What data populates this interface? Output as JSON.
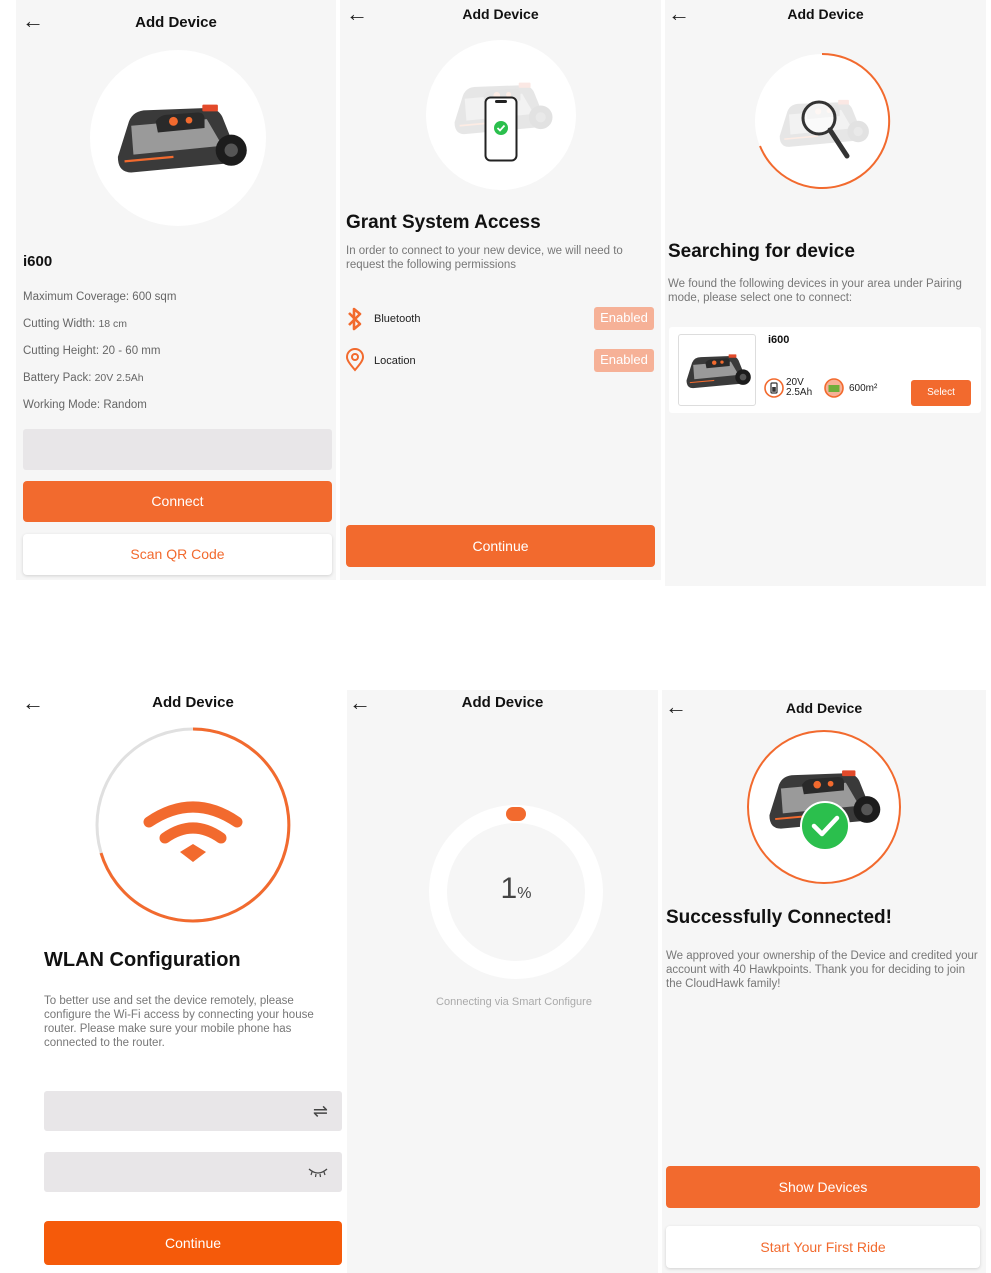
{
  "common": {
    "back_arrow": "←",
    "header_title": "Add Device"
  },
  "screen1": {
    "model": "i600",
    "specs": [
      {
        "label": "Maximum Coverage:",
        "value": "600 sqm"
      },
      {
        "label": "Cutting Width:",
        "value": "18 cm"
      },
      {
        "label": "Cutting Height:",
        "value": "20 - 60 mm"
      },
      {
        "label": "Battery Pack:",
        "value": "20V 2.5Ah"
      },
      {
        "label": "Working Mode:",
        "value": "Random"
      }
    ],
    "connect_label": "Connect",
    "scan_label": "Scan QR Code"
  },
  "screen2": {
    "heading": "Grant System Access",
    "description": "In order to connect to your new device, we will need to request the following permissions",
    "permissions": [
      {
        "name": "Bluetooth",
        "status": "Enabled"
      },
      {
        "name": "Location",
        "status": "Enabled"
      }
    ],
    "continue_label": "Continue"
  },
  "screen3": {
    "heading": "Searching for device",
    "description": "We found the following devices in your area under Pairing mode, please select one to connect:",
    "device": {
      "name": "i600",
      "battery_volts": "20V",
      "battery_capacity": "2.5Ah",
      "coverage": "600m²",
      "select_label": "Select"
    }
  },
  "screen4": {
    "heading": "WLAN Configuration",
    "description": "To better use and set the device remotely, please configure the Wi-Fi access by connecting your house router. Please make sure your mobile phone has connected to the router.",
    "swap_icon": "⇌",
    "continue_label": "Continue"
  },
  "screen5": {
    "progress_value": "1",
    "progress_unit": "%",
    "status_text": "Connecting via Smart Configure"
  },
  "screen6": {
    "heading": "Successfully Connected!",
    "description": "We approved your ownership of the Device and credited your account with 40 Hawkpoints. Thank you for deciding to join the CloudHawk family!",
    "show_devices_label": "Show Devices",
    "first_ride_label": "Start Your First Ride"
  },
  "colors": {
    "accent": "#f26a2e",
    "accent_light": "#f6b197",
    "success": "#2bbf4d"
  }
}
